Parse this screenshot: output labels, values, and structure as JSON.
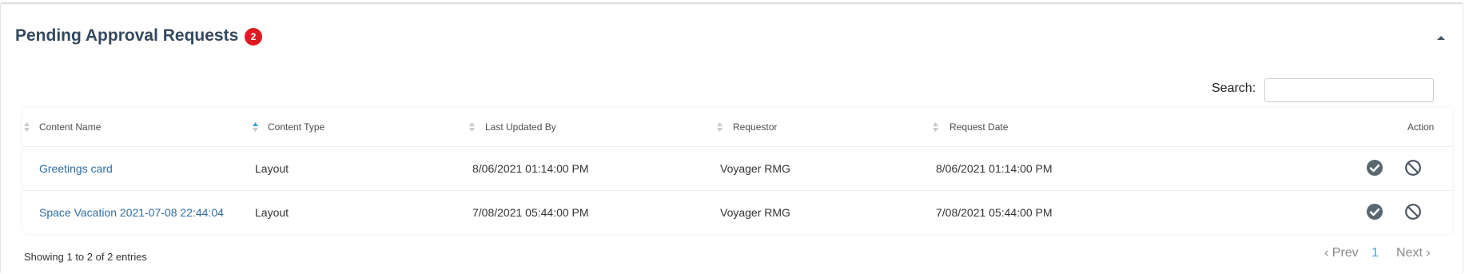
{
  "panel": {
    "title": "Pending Approval Requests",
    "badge_count": "2",
    "collapse_icon": "caret-up-icon"
  },
  "search": {
    "label": "Search:",
    "value": "",
    "placeholder": ""
  },
  "table": {
    "columns": [
      "Content Name",
      "Content Type",
      "Last Updated By",
      "Requestor",
      "Request Date",
      "Action"
    ],
    "sorted_column": "Content Type",
    "rows": [
      {
        "content_name": "Greetings card",
        "content_type": "Layout",
        "last_updated_by": "8/06/2021 01:14:00 PM",
        "requestor": "Voyager RMG",
        "request_date": "8/06/2021 01:14:00 PM"
      },
      {
        "content_name": "Space Vacation 2021-07-08 22:44:04",
        "content_type": "Layout",
        "last_updated_by": "7/08/2021 05:44:00 PM",
        "requestor": "Voyager RMG",
        "request_date": "7/08/2021 05:44:00 PM"
      }
    ],
    "action_icons": [
      "check-circle-icon",
      "ban-icon"
    ]
  },
  "footer": {
    "info": "Showing 1 to 2 of 2 entries",
    "prev": "Prev",
    "current_page": "1",
    "next": "Next"
  },
  "colors": {
    "title": "#34495e",
    "badge": "#e01a22",
    "link": "#2e6da4",
    "active_page": "#3aa3d6",
    "action_icon": "#5b6770"
  }
}
